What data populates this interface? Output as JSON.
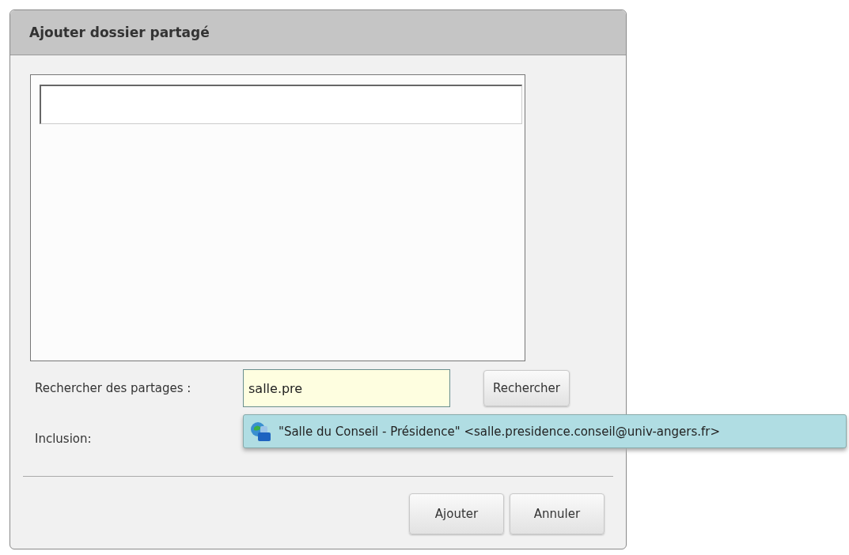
{
  "dialog": {
    "title": "Ajouter dossier partagé"
  },
  "search": {
    "label": "Rechercher des partages :",
    "value": "salle.pre",
    "button": "Rechercher"
  },
  "suggestions": [
    {
      "text": "\"Salle du Conseil - Présidence\" <salle.presidence.conseil@univ-angers.fr>",
      "selected": true
    }
  ],
  "inclusion": {
    "label": "Inclusion:"
  },
  "buttons": [
    "Ajouter",
    "Annuler"
  ]
}
